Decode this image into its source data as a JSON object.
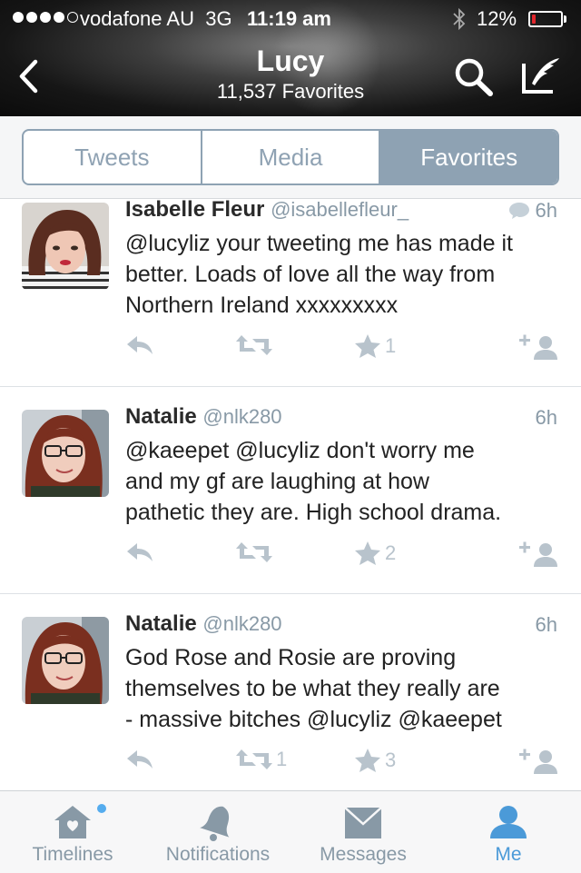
{
  "status": {
    "carrier": "vodafone AU",
    "network": "3G",
    "time": "11:19 am",
    "battery": "12%",
    "battery_level": 0.12,
    "battery_color": "#e0262c"
  },
  "nav": {
    "title": "Lucy",
    "subtitle": "11,537 Favorites"
  },
  "segments": [
    "Tweets",
    "Media",
    "Favorites"
  ],
  "tweets": [
    {
      "name": "Isabelle Fleur",
      "handle": "@isabellefleur_",
      "time": "6h",
      "has_reply_icon": true,
      "lines": [
        "@lucyliz your tweeting me has made it",
        "better. Loads of love all the way from",
        "Northern Ireland xxxxxxxxx"
      ],
      "retweets": "",
      "favorites": "1"
    },
    {
      "name": "Natalie",
      "handle": "@nlk280",
      "time": "6h",
      "lines": [
        "@kaeepet @lucyliz don't worry me",
        "and my gf are laughing at how",
        "pathetic they are. High school drama."
      ],
      "retweets": "",
      "favorites": "2"
    },
    {
      "name": "Natalie",
      "handle": "@nlk280",
      "time": "6h",
      "lines": [
        "God Rose and Rosie are proving",
        "themselves to be what they really are",
        "- massive bitches @lucyliz @kaeepet"
      ],
      "retweets": "1",
      "favorites": "3"
    }
  ],
  "tabs": [
    {
      "label": "Timelines",
      "icon": "home-icon"
    },
    {
      "label": "Notifications",
      "icon": "bell-icon"
    },
    {
      "label": "Messages",
      "icon": "envelope-icon"
    },
    {
      "label": "Me",
      "icon": "person-icon"
    }
  ],
  "colors": {
    "accent": "#55acee",
    "segment": "#8ea2b3",
    "muted": "#8899a6",
    "action": "#b8c3cc"
  }
}
